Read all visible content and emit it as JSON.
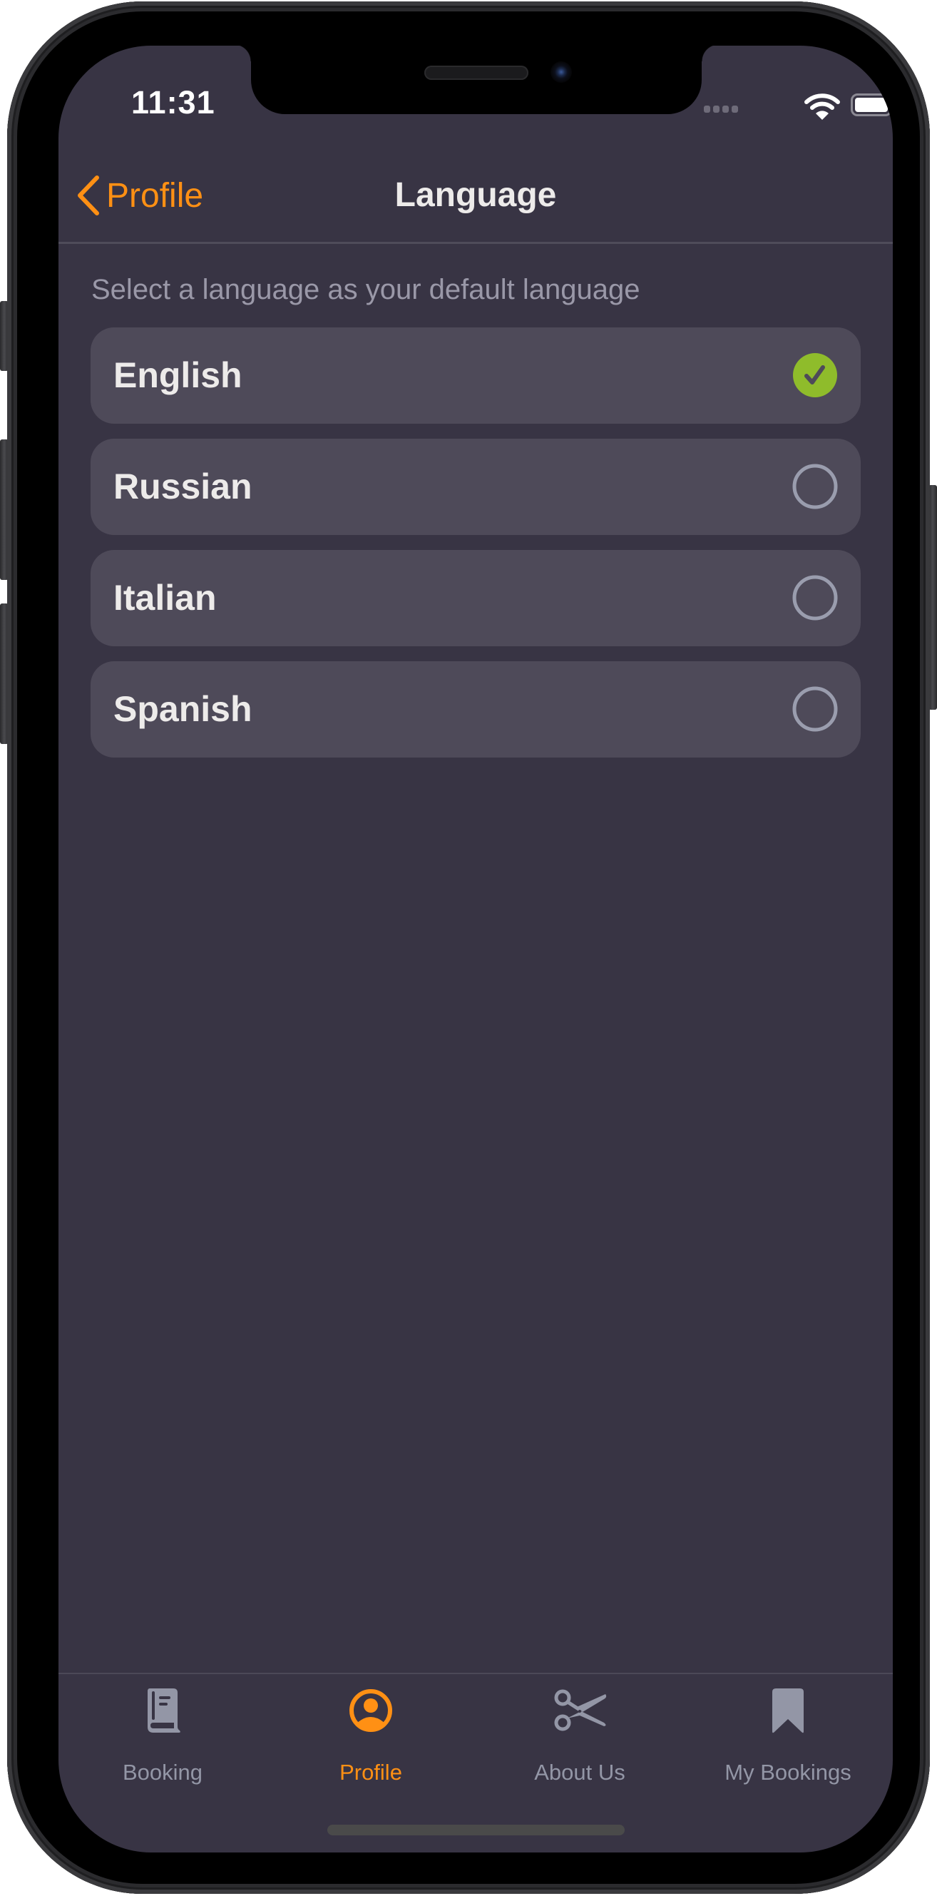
{
  "status_bar": {
    "time": "11:31",
    "icons": [
      "cellular-signal-icon",
      "wifi-icon",
      "battery-icon"
    ]
  },
  "nav": {
    "back_label": "Profile",
    "back_icon": "chevron-left-icon",
    "title": "Language"
  },
  "content": {
    "subtitle": "Select a language as your default language",
    "languages": [
      {
        "label": "English",
        "selected": true
      },
      {
        "label": "Russian",
        "selected": false
      },
      {
        "label": "Italian",
        "selected": false
      },
      {
        "label": "Spanish",
        "selected": false
      }
    ]
  },
  "tab_bar": {
    "tabs": [
      {
        "label": "Booking",
        "icon": "book-icon",
        "active": false
      },
      {
        "label": "Profile",
        "icon": "person-circle-icon",
        "active": true
      },
      {
        "label": "About Us",
        "icon": "scissors-icon",
        "active": false
      },
      {
        "label": "My Bookings",
        "icon": "bookmark-icon",
        "active": false
      }
    ]
  },
  "colors": {
    "accent": "#FF9014",
    "background": "#383444",
    "card": "#4E4A59",
    "selected_check": "#8FBC2B",
    "inactive": "#9396A6",
    "text": "#EDEBEA"
  }
}
